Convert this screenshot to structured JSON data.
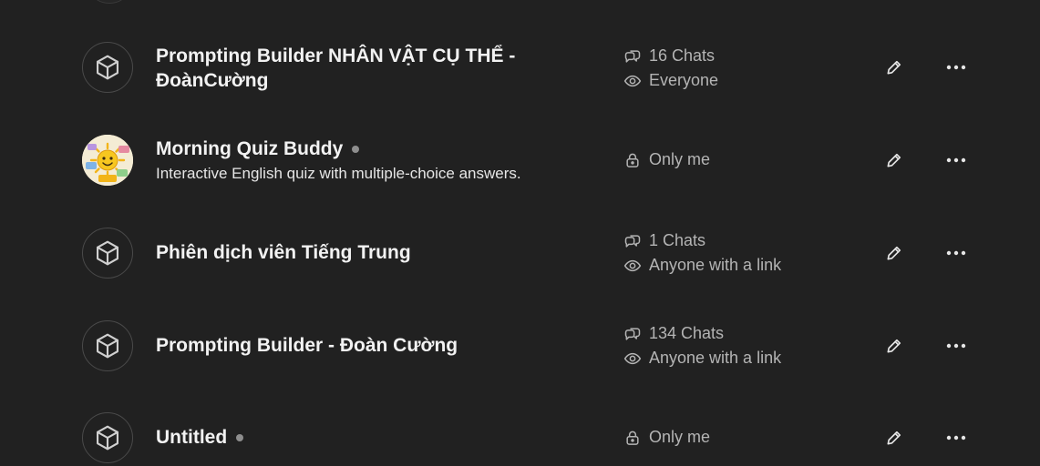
{
  "gpts": [
    {
      "title": "Prompting Builder NHÂN VẬT CỤ THỂ - ĐoànCường",
      "title_line1": "Prompting Builder NHÂN VẬT CỤ THỂ -",
      "title_line2": "ĐoànCường",
      "description": "",
      "chats": "16 Chats",
      "visibility": "Everyone",
      "visibility_icon": "eye-icon",
      "avatar": "cube-icon",
      "draft_dot": false
    },
    {
      "title": "Morning Quiz Buddy",
      "description": "Interactive English quiz with multiple-choice answers.",
      "chats": "",
      "visibility": "Only me",
      "visibility_icon": "lock-icon",
      "avatar": "sun-quiz-image",
      "draft_dot": true
    },
    {
      "title": "Phiên dịch viên Tiếng Trung",
      "description": "",
      "chats": "1 Chats",
      "visibility": "Anyone with a link",
      "visibility_icon": "eye-icon",
      "avatar": "cube-icon",
      "draft_dot": false
    },
    {
      "title": "Prompting Builder - Đoàn Cường",
      "description": "",
      "chats": "134 Chats",
      "visibility": "Anyone with a link",
      "visibility_icon": "eye-icon",
      "avatar": "cube-icon",
      "draft_dot": false
    },
    {
      "title": "Untitled",
      "description": "",
      "chats": "",
      "visibility": "Only me",
      "visibility_icon": "lock-icon",
      "avatar": "cube-icon",
      "draft_dot": true
    }
  ],
  "colors": {
    "background": "#212121",
    "title": "#f2f2f2",
    "meta": "#b4b4b4",
    "dot": "#8e8e8e"
  }
}
